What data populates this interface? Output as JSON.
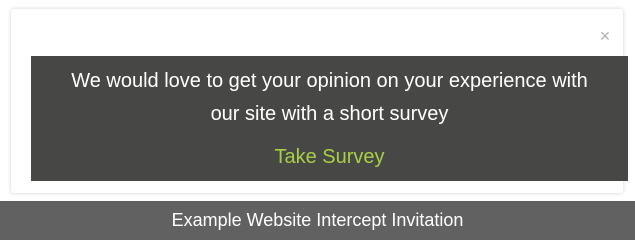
{
  "invitation": {
    "close_symbol": "×",
    "message": "We would love to get your opinion on your experience with our site with a short survey",
    "take_survey_label": "Take Survey",
    "link_color": "#a8cf45",
    "panel_color": "#474846"
  },
  "footer": {
    "caption": "Example Website Intercept Invitation"
  }
}
